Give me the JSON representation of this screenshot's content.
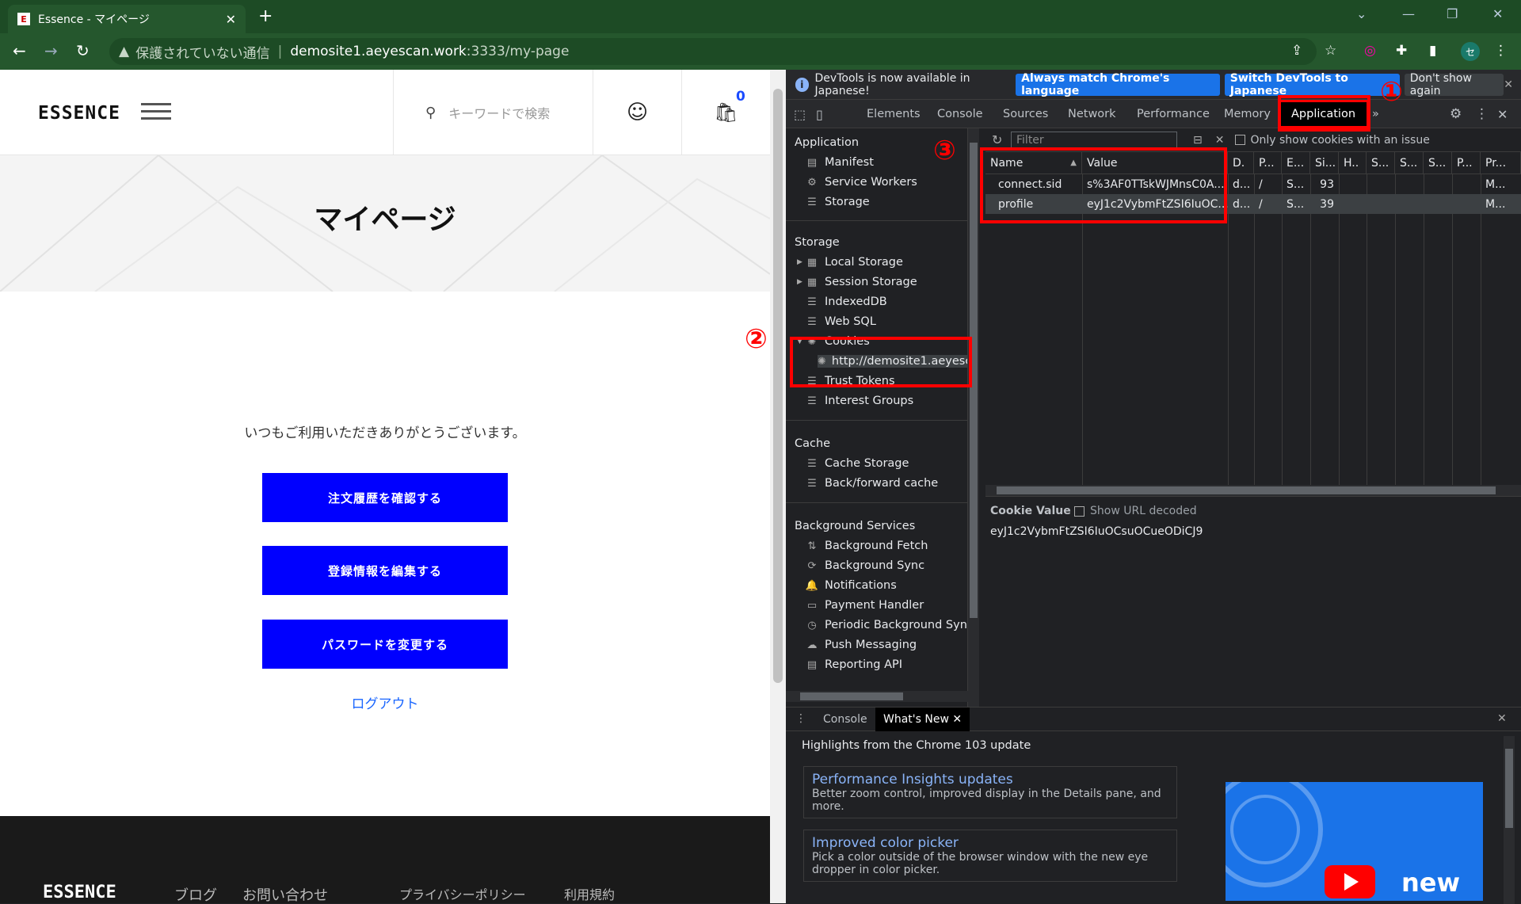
{
  "browser": {
    "tab_title": "Essence - マイページ",
    "tab_favicon": "E",
    "tab_close": "✕",
    "new_tab": "+",
    "security_label": "保護されていない通信",
    "url_host": "demosite1.aeyescan.work",
    "url_rest": ":3333/my-page",
    "profile_initial": "セ"
  },
  "site": {
    "logo": "ESSENCE",
    "search_placeholder": "キーワードで検索",
    "cart_count": "0",
    "page_title": "マイページ",
    "greeting": "いつもご利用いただきありがとうございます。",
    "buttons": [
      "注文履歴を確認する",
      "登録情報を編集する",
      "パスワードを変更する"
    ],
    "logout": "ログアウト",
    "footer_logo": "ESSENCE",
    "footer_links": [
      "ブログ",
      "お問い合わせ",
      "プライバシーポリシー",
      "利用規約"
    ]
  },
  "devtools": {
    "infobar": {
      "message": "DevTools is now available in Japanese!",
      "btn_match": "Always match Chrome's language",
      "btn_switch": "Switch DevTools to Japanese",
      "btn_dismiss": "Don't show again"
    },
    "tabs": [
      "Elements",
      "Console",
      "Sources",
      "Network",
      "Performance",
      "Memory",
      "Application"
    ],
    "sidebar": {
      "application_header": "Application",
      "application_items": [
        "Manifest",
        "Service Workers",
        "Storage"
      ],
      "storage_header": "Storage",
      "storage_items": [
        "Local Storage",
        "Session Storage",
        "IndexedDB",
        "Web SQL",
        "Cookies",
        "http://demosite1.aeyesc",
        "Trust Tokens",
        "Interest Groups"
      ],
      "cache_header": "Cache",
      "cache_items": [
        "Cache Storage",
        "Back/forward cache"
      ],
      "bg_header": "Background Services",
      "bg_items": [
        "Background Fetch",
        "Background Sync",
        "Notifications",
        "Payment Handler",
        "Periodic Background Sync",
        "Push Messaging",
        "Reporting API"
      ]
    },
    "cookies": {
      "filter_placeholder": "Filter",
      "only_issue_label": "Only show cookies with an issue",
      "columns": [
        "Name",
        "Value",
        "D.",
        "P...",
        "E...",
        "Si...",
        "H..",
        "S...",
        "S...",
        "S...",
        "P...",
        "Pr..."
      ],
      "rows": [
        {
          "name": "connect.sid",
          "value": "s%3AF0TTskWJMnsC0A...",
          "domain": "d...",
          "path": "/",
          "expires": "S...",
          "size": "93",
          "priority": "M..."
        },
        {
          "name": "profile",
          "value": "eyJ1c2VybmFtZSI6IuOC...",
          "domain": "d...",
          "path": "/",
          "expires": "S...",
          "size": "39",
          "priority": "M..."
        }
      ],
      "value_pane_label": "Cookie Value",
      "show_decoded_label": "Show URL decoded",
      "selected_value": "eyJ1c2VybmFtZSI6IuOCsuOCueODiCJ9"
    },
    "drawer": {
      "tabs": [
        "Console",
        "What's New"
      ],
      "headline": "Highlights from the Chrome 103 update",
      "cards": [
        {
          "title": "Performance Insights updates",
          "desc": "Better zoom control, improved display in the Details pane, and more."
        },
        {
          "title": "Improved color picker",
          "desc": "Pick a color outside of the browser window with the new eye dropper in color picker."
        }
      ],
      "promo_text": "new"
    }
  },
  "annotations": [
    "①",
    "②",
    "③"
  ],
  "colors": {
    "annotation_red": "#ff0000",
    "site_button": "#0000ff",
    "browser_green": "#25572d"
  }
}
